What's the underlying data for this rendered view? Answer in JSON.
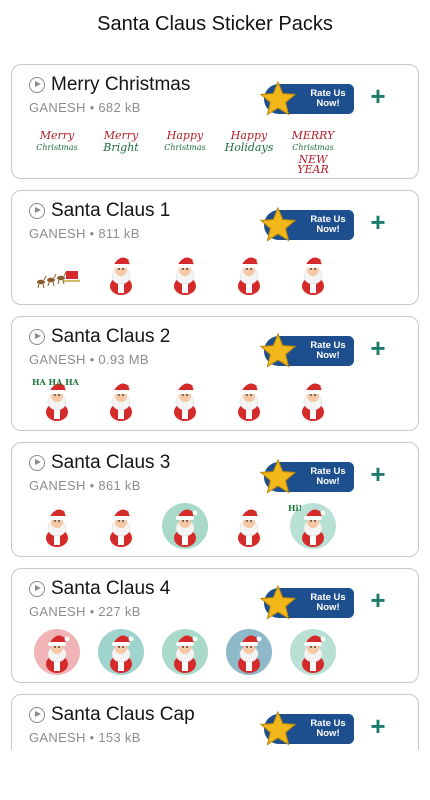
{
  "app": {
    "title": "Santa Claus Sticker Packs"
  },
  "colors": {
    "accent": "#1d4f8e",
    "add": "#1d7a6e",
    "santa_red": "#d42a2a",
    "star_gold": "#f2b81a"
  },
  "rate_button": {
    "line1": "Rate Us",
    "line2": "Now!"
  },
  "packs": [
    {
      "name": "Merry Christmas",
      "author": "GANESH",
      "size": "682 kB",
      "stickers": [
        {
          "type": "text",
          "lines": [
            "Merry",
            "Christmas"
          ]
        },
        {
          "type": "text",
          "lines": [
            "Merry",
            "Bright"
          ]
        },
        {
          "type": "text",
          "lines": [
            "Happy",
            "Christmas"
          ]
        },
        {
          "type": "text",
          "lines": [
            "Happy",
            "Holidays"
          ]
        },
        {
          "type": "text",
          "lines": [
            "MERRY",
            "Christmas",
            "NEW YEAR"
          ]
        }
      ]
    },
    {
      "name": "Santa Claus 1",
      "author": "GANESH",
      "size": "811 kB",
      "stickers": [
        {
          "type": "sleigh"
        },
        {
          "type": "santa"
        },
        {
          "type": "santa"
        },
        {
          "type": "santa"
        },
        {
          "type": "santa"
        }
      ]
    },
    {
      "name": "Santa Claus 2",
      "author": "GANESH",
      "size": "0.93 MB",
      "stickers": [
        {
          "type": "santa",
          "label": "HA HA HA"
        },
        {
          "type": "santa"
        },
        {
          "type": "santa"
        },
        {
          "type": "santa"
        },
        {
          "type": "santa"
        }
      ]
    },
    {
      "name": "Santa Claus 3",
      "author": "GANESH",
      "size": "861 kB",
      "stickers": [
        {
          "type": "santa"
        },
        {
          "type": "santa"
        },
        {
          "type": "santa-circle"
        },
        {
          "type": "santa"
        },
        {
          "type": "santa-circle",
          "label": "Hi!"
        }
      ]
    },
    {
      "name": "Santa Claus 4",
      "author": "GANESH",
      "size": "227 kB",
      "stickers": [
        {
          "type": "santa-circle"
        },
        {
          "type": "santa-circle"
        },
        {
          "type": "santa-circle"
        },
        {
          "type": "santa-circle"
        },
        {
          "type": "santa-circle"
        }
      ]
    },
    {
      "name": "Santa Claus Cap",
      "author": "GANESH",
      "size": "153 kB",
      "stickers": []
    }
  ]
}
